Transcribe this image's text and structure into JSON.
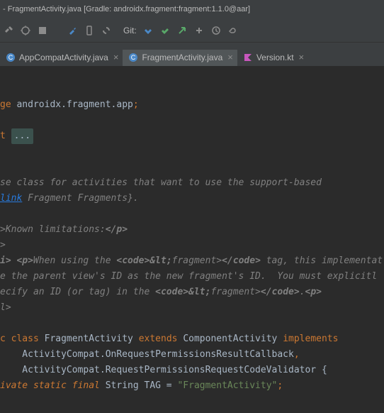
{
  "title_bar": {
    "text": "- FragmentActivity.java [Gradle: androidx.fragment:fragment:1.1.0@aar]"
  },
  "toolbar": {
    "git_label": "Git:"
  },
  "tabs": [
    {
      "label": "AppCompatActivity.java",
      "active": false,
      "type": "java"
    },
    {
      "label": "FragmentActivity.java",
      "active": true,
      "type": "java"
    },
    {
      "label": "Version.kt",
      "active": false,
      "type": "kt"
    }
  ],
  "code": {
    "pkg_kw": "ge",
    "pkg_name": " androidx.fragment.app",
    "pkg_semi": ";",
    "fold": "...",
    "doc1": "se class for activities that want to use the support-based",
    "doc2a": "link",
    "doc2b": " Fragment Fragments}.",
    "doc3a": ">Known limitations:",
    "doc3b": "</p>",
    "doc4": ">",
    "doc5a": "i> <p>",
    "doc5b": "When using the ",
    "doc5c": "<code>&lt;",
    "doc5d": "fragment>",
    "doc5e": "</code>",
    "doc5f": " tag, this implementat",
    "doc6": "e the parent view's ID as the new fragment's ID.  You must explicitl",
    "doc7a": "ecify an ID (or tag) in the ",
    "doc7b": "<code>&lt;",
    "doc7c": "fragment>",
    "doc7d": "</code>",
    "doc7e": ".<p>",
    "doc8": "l>",
    "l1a": "c ",
    "l1b": "class ",
    "l1c": "FragmentActivity ",
    "l1d": "extends ",
    "l1e": "ComponentActivity ",
    "l1f": "implements",
    "l2a": "    ActivityCompat.OnRequestPermissionsResultCallback",
    "l2b": ",",
    "l3a": "    ActivityCompat.RequestPermissionsRequestCodeValidator ",
    "l3b": "{",
    "l4a": "ivate static final ",
    "l4b": "String TAG = ",
    "l4c": "\"FragmentActivity\"",
    "l4d": ";"
  }
}
